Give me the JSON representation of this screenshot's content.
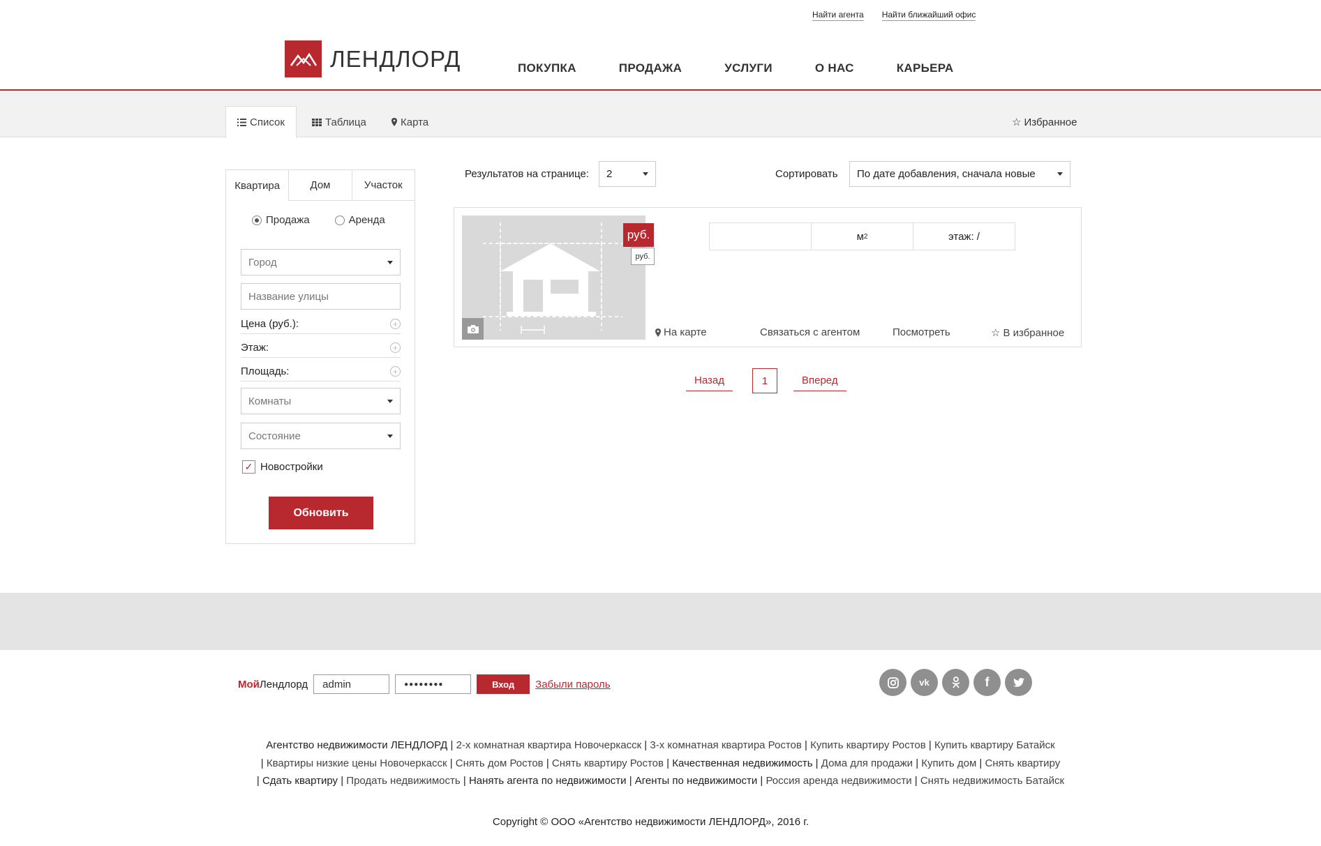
{
  "util_links": [
    "Найти агента",
    "Найти ближайший офис"
  ],
  "logo": {
    "text": "ЛЕНДЛОРД",
    "brand_color": "#b8292f"
  },
  "nav": [
    "ПОКУПКА",
    "ПРОДАЖА",
    "УСЛУГИ",
    "О НАС",
    "КАРЬЕРА"
  ],
  "view_tabs": {
    "list": "Список",
    "table": "Таблица",
    "map": "Карта",
    "favorites": "Избранное"
  },
  "filter": {
    "tabs": [
      "Квартира",
      "Дом",
      "Участок"
    ],
    "deal": {
      "sale": "Продажа",
      "rent": "Аренда",
      "selected": "Продажа"
    },
    "city_placeholder": "Город",
    "street_placeholder": "Название улицы",
    "price_label": "Цена (руб.):",
    "floor_label": "Этаж:",
    "area_label": "Площадь:",
    "rooms_placeholder": "Комнаты",
    "state_placeholder": "Состояние",
    "new_buildings_label": "Новостройки",
    "new_buildings_checked": true,
    "update_button": "Обновить"
  },
  "toolbar": {
    "per_page_label": "Результатов на странице:",
    "per_page_value": "2",
    "sort_label": "Сортировать",
    "sort_value": "По дате добавления, сначала новые"
  },
  "listing": {
    "price_currency": "руб.",
    "price_sub": "руб.",
    "area_unit": "м",
    "area_sup": "2",
    "floor": "этаж: /",
    "actions": {
      "map": "На карте",
      "contact": "Связаться с агентом",
      "view": "Посмотреть",
      "fav": "В избранное"
    }
  },
  "pagination": {
    "prev": "Назад",
    "current": "1",
    "next": "Вперед"
  },
  "login": {
    "brand_red": "Мой",
    "brand_black": "Лендлорд",
    "username": "admin",
    "password_mask": "●●●●●●●●",
    "button": "Вход",
    "forgot": "Забыли пароль"
  },
  "social": [
    "instagram-icon",
    "vk-icon",
    "odnoklassniki-icon",
    "facebook-icon",
    "twitter-icon"
  ],
  "seo_line1": [
    "Агентство недвижимости ЛЕНДЛОРД",
    "2-х комнатная квартира Новочеркасск",
    "3-х комнатная квартира Ростов",
    "Купить квартиру Ростов",
    "Купить квартиру Батайск"
  ],
  "seo_line2": [
    "Квартиры низкие цены Новочеркасск",
    "Снять дом Ростов",
    "Снять квартиру Ростов",
    "Качественная недвижимость",
    "Дома для продажи",
    "Купить дом",
    "Снять квартиру"
  ],
  "seo_line3": [
    "Сдать квартиру",
    "Продать недвижимость",
    "Нанять агента по недвижимости",
    "Агенты по недвижимости",
    "Россия аренда недвижимости",
    "Снять недвижимость Батайск"
  ],
  "copyright": "Copyright © ООО «Агентство недвижимости ЛЕНДЛОРД», 2016 г."
}
